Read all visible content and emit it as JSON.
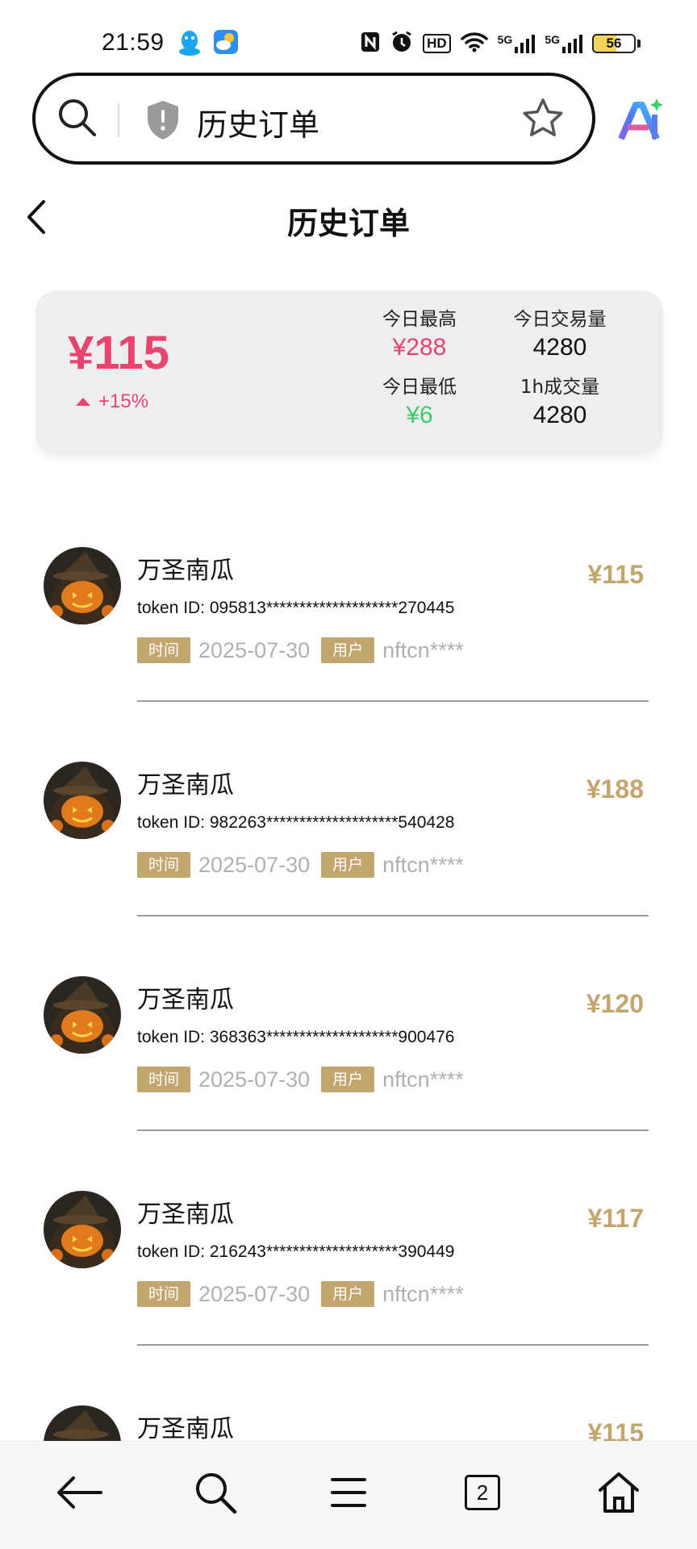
{
  "status_bar": {
    "time": "21:59",
    "battery": "56",
    "battery_level_percent": 56,
    "icons": [
      "qq-icon",
      "weather-icon",
      "nfc-icon",
      "alarm-icon",
      "hd-icon",
      "wifi-icon",
      "signal-5g-icon",
      "signal-5g-icon",
      "battery-icon"
    ],
    "hd_label": "HD",
    "net_label_1": "5G",
    "net_label_2": "5G"
  },
  "address_bar": {
    "title": "历史订单"
  },
  "header": {
    "title": "历史订单"
  },
  "summary": {
    "price": "¥115",
    "change": "+15%",
    "today_high_label": "今日最高",
    "today_high_value": "¥288",
    "today_volume_label": "今日交易量",
    "today_volume_value": "4280",
    "today_low_label": "今日最低",
    "today_low_value": "¥6",
    "hour_volume_label": "1h成交量",
    "hour_volume_value": "4280"
  },
  "orders": [
    {
      "name": "万圣南瓜",
      "token": "token ID: 095813********************270445",
      "time_tag": "时间",
      "time": "2025-07-30",
      "user_tag": "用户",
      "user": "nftcn****",
      "price": "¥115"
    },
    {
      "name": "万圣南瓜",
      "token": "token ID: 982263********************540428",
      "time_tag": "时间",
      "time": "2025-07-30",
      "user_tag": "用户",
      "user": "nftcn****",
      "price": "¥188"
    },
    {
      "name": "万圣南瓜",
      "token": "token ID: 368363********************900476",
      "time_tag": "时间",
      "time": "2025-07-30",
      "user_tag": "用户",
      "user": "nftcn****",
      "price": "¥120"
    },
    {
      "name": "万圣南瓜",
      "token": "token ID: 216243********************390449",
      "time_tag": "时间",
      "time": "2025-07-30",
      "user_tag": "用户",
      "user": "nftcn****",
      "price": "¥117"
    },
    {
      "name": "万圣南瓜",
      "price": "¥115"
    }
  ],
  "bottom_nav": {
    "tab_count": "2",
    "icons": [
      "back-arrow-icon",
      "search-icon",
      "menu-icon",
      "tabs-icon",
      "home-icon"
    ]
  },
  "colors": {
    "accent_red": "#e8446d",
    "accent_green": "#3ecb6a",
    "gold": "#c3a56e",
    "card_bg": "#eeedf0"
  }
}
